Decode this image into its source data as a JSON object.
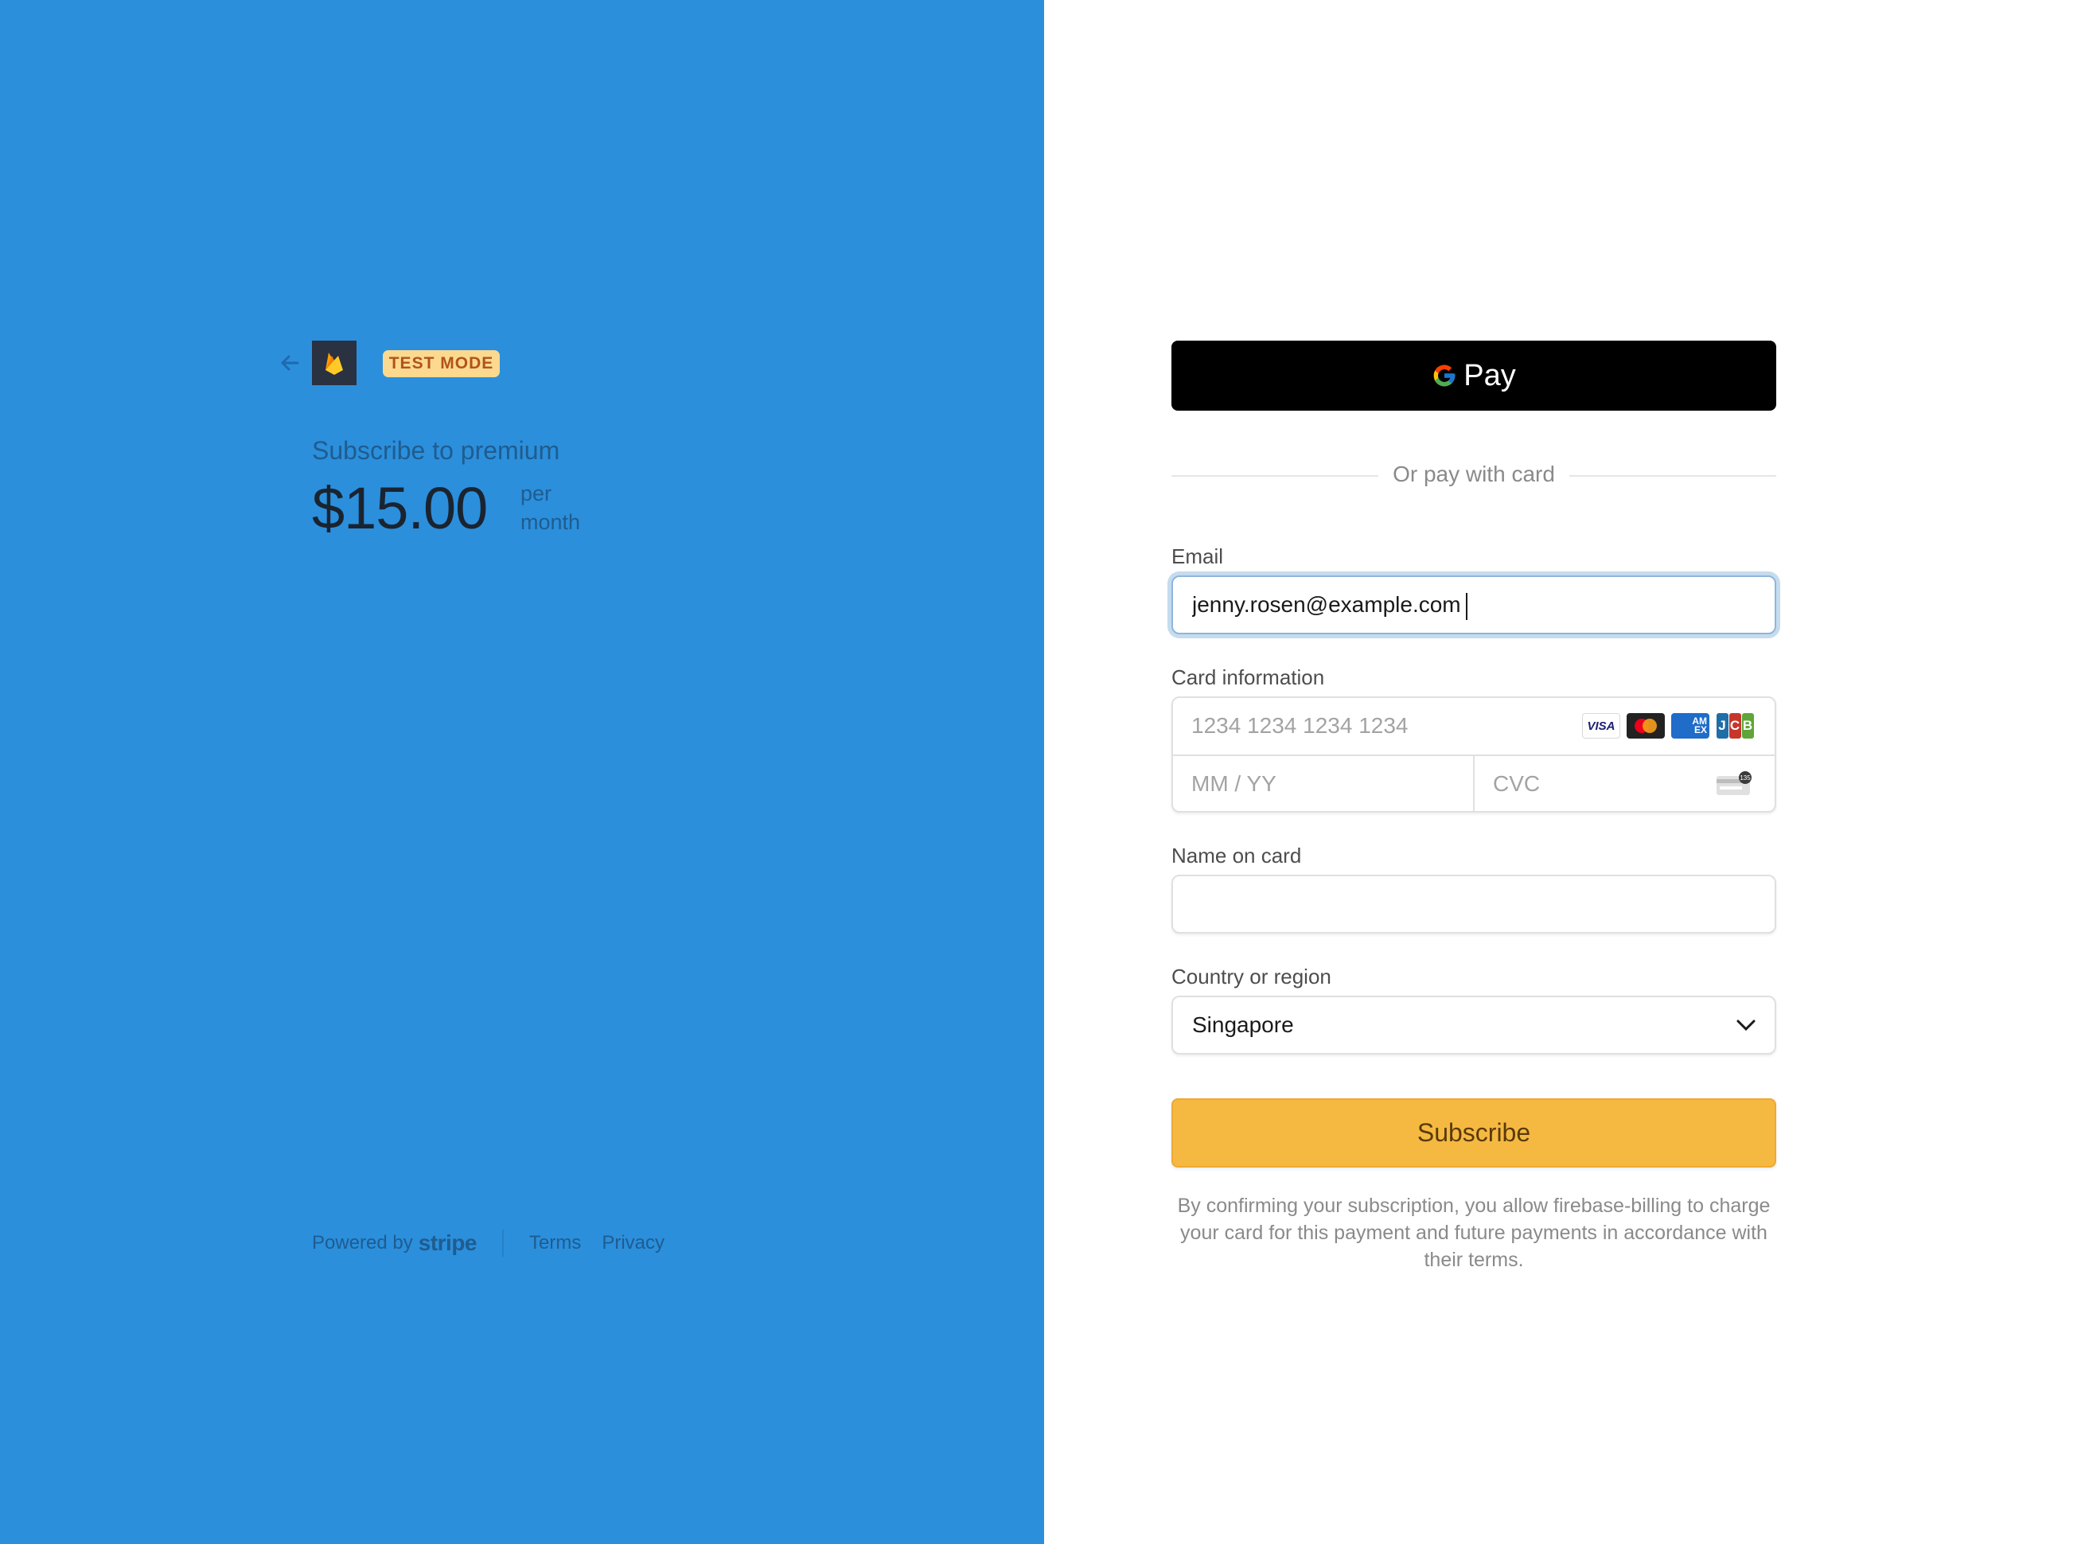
{
  "summary": {
    "back_label": "Back",
    "merchant_logo": "firebase-logo",
    "badge": "TEST MODE",
    "product_name": "Subscribe to premium",
    "price": "$15.00",
    "interval_line1": "per",
    "interval_line2": "month",
    "colors": {
      "panel": "#2B8FDC",
      "badge_bg": "#FCD98F",
      "badge_text": "#B0541A"
    }
  },
  "footer": {
    "powered_by": "Powered by",
    "brand": "stripe",
    "links": [
      "Terms",
      "Privacy"
    ]
  },
  "payment": {
    "gpay_label": "Pay",
    "divider_text": "Or pay with card",
    "email": {
      "label": "Email",
      "value": "jenny.rosen@example.com"
    },
    "card": {
      "label": "Card information",
      "number_placeholder": "1234 1234 1234 1234",
      "expiry_placeholder": "MM / YY",
      "cvc_placeholder": "CVC",
      "brands": [
        "VISA",
        "Mastercard",
        "AMEX",
        "JCB"
      ],
      "cvc_hint": "135"
    },
    "name": {
      "label": "Name on card",
      "value": ""
    },
    "country": {
      "label": "Country or region",
      "value": "Singapore"
    },
    "submit_label": "Subscribe",
    "legal": "By confirming your subscription, you allow firebase-billing to charge your card for this payment and future payments in accordance with their terms.",
    "colors": {
      "submit": "#F5B942",
      "gpay": "#000000"
    }
  }
}
